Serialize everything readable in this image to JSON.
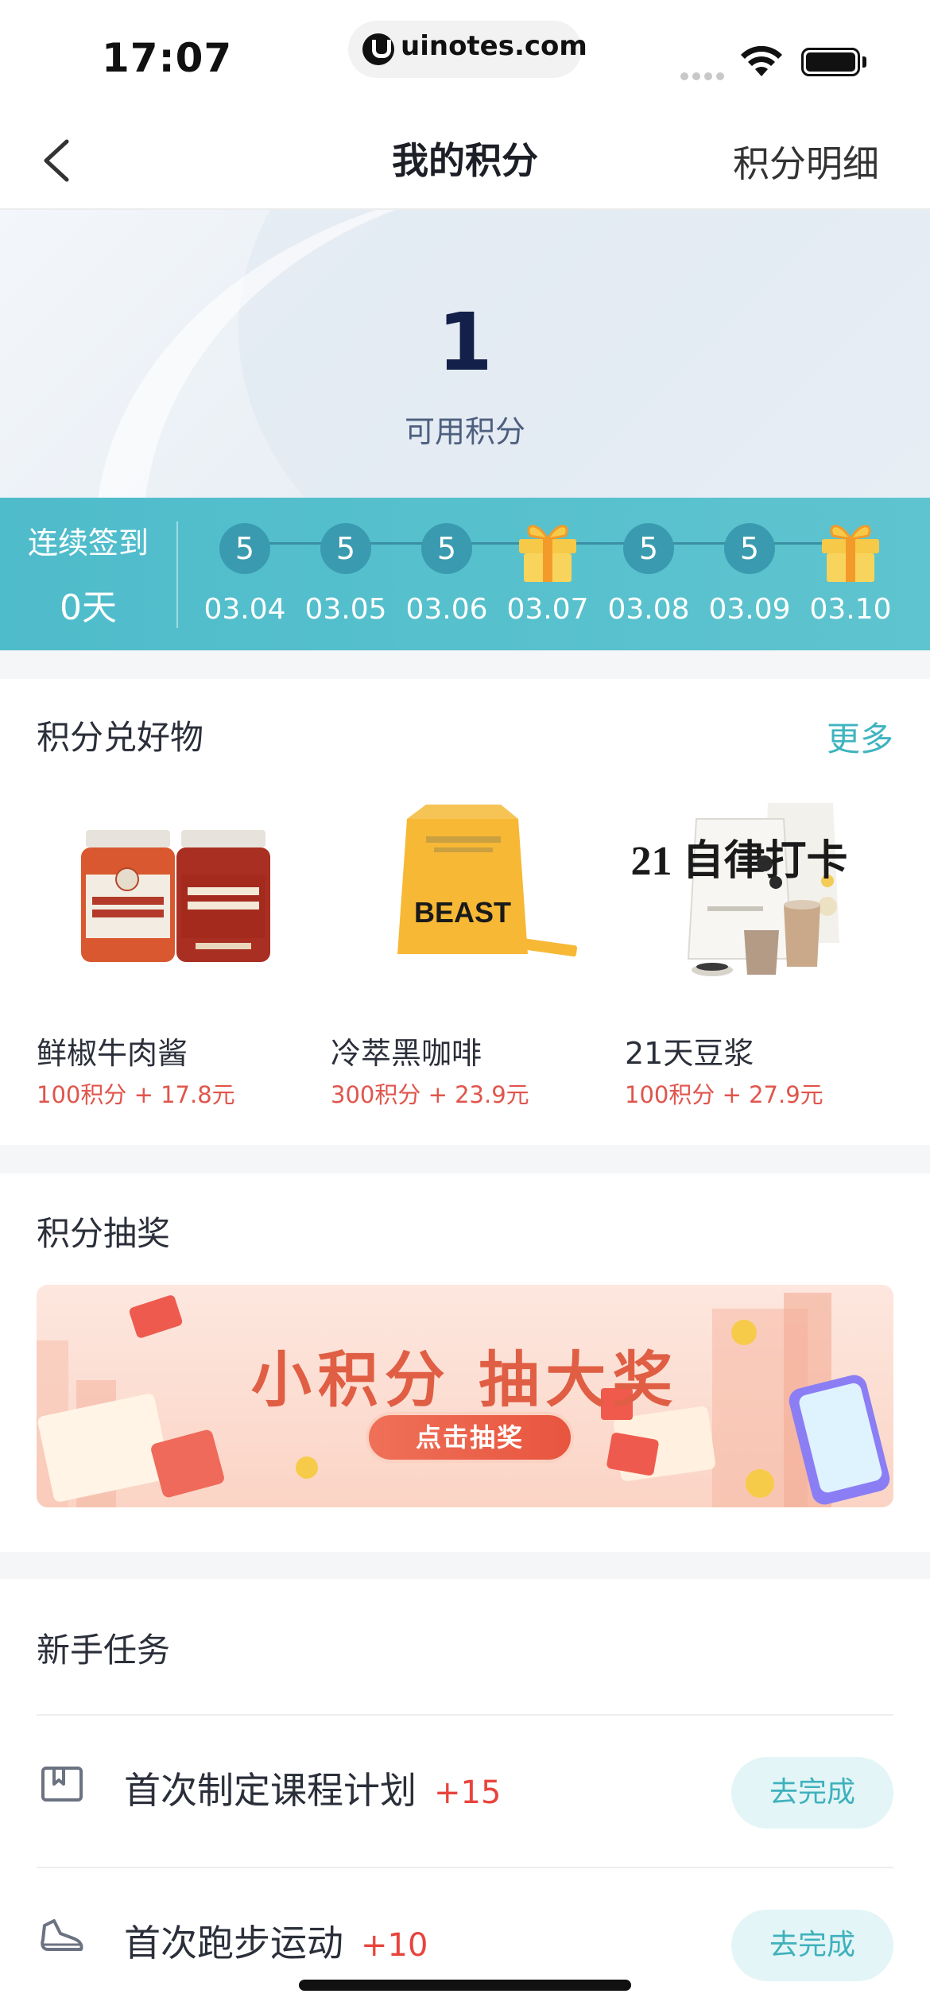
{
  "status_bar": {
    "time": "17:07",
    "url": "uinotes.com"
  },
  "nav": {
    "title": "我的积分",
    "right_link": "积分明细"
  },
  "points": {
    "value": "1",
    "label": "可用积分"
  },
  "checkin": {
    "title": "连续签到",
    "days": "0天",
    "items": [
      {
        "type": "points",
        "value": "5",
        "date": "03.04"
      },
      {
        "type": "points",
        "value": "5",
        "date": "03.05"
      },
      {
        "type": "points",
        "value": "5",
        "date": "03.06"
      },
      {
        "type": "gift",
        "icon": "gift-icon",
        "date": "03.07"
      },
      {
        "type": "points",
        "value": "5",
        "date": "03.08"
      },
      {
        "type": "points",
        "value": "5",
        "date": "03.09"
      },
      {
        "type": "gift",
        "icon": "gift-icon",
        "date": "03.10"
      }
    ]
  },
  "goods": {
    "title": "积分兑好物",
    "more": "更多",
    "items": [
      {
        "name": "鲜椒牛肉酱",
        "price": "100积分 + 17.8元",
        "image": "sauce-jars-image"
      },
      {
        "name": "冷萃黑咖啡",
        "price": "300积分 + 23.9元",
        "image": "coffee-bag-image",
        "package_text": "BEAST"
      },
      {
        "name": "21天豆浆",
        "price": "100积分 + 27.9元",
        "image": "soy-milk-bag-image",
        "package_text": "21 自律打卡"
      }
    ]
  },
  "lottery": {
    "title": "积分抽奖",
    "banner_title": "小积分 抽大奖",
    "banner_button": "点击抽奖"
  },
  "tasks": {
    "title": "新手任务",
    "items": [
      {
        "label": "首次制定课程计划",
        "points": "+15",
        "button": "去完成",
        "icon": "bookmark-icon"
      },
      {
        "label": "首次跑步运动",
        "points": "+10",
        "button": "去完成",
        "icon": "running-shoe-icon"
      }
    ]
  },
  "colors": {
    "accent": "#3fb4c0",
    "checkin_bg": "#55bfcc",
    "price_red": "#e0554c",
    "banner_red": "#e05e44"
  }
}
